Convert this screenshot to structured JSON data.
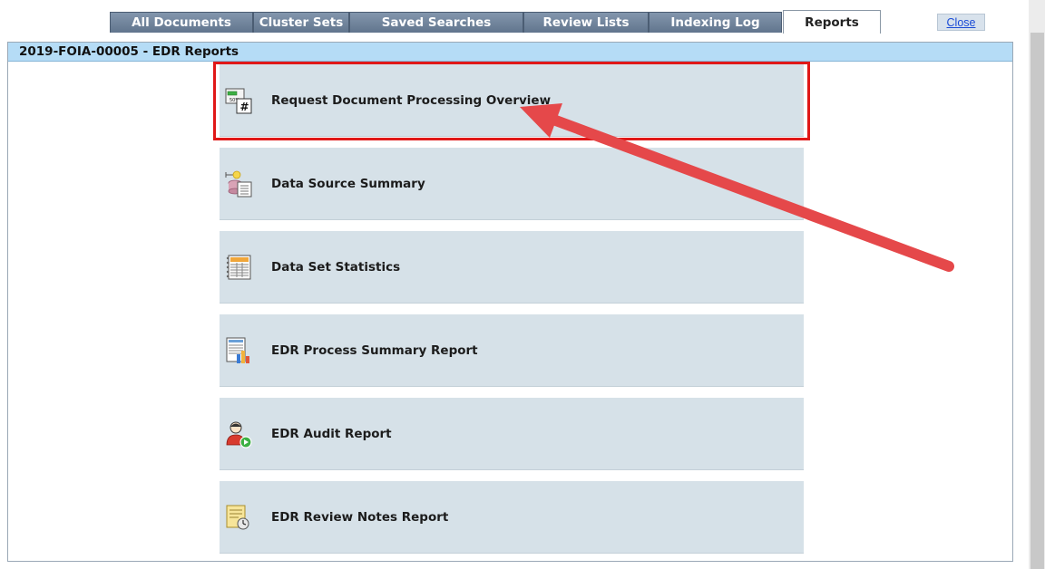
{
  "tabs": [
    {
      "label": "All Documents",
      "active": false
    },
    {
      "label": "Cluster Sets",
      "active": false
    },
    {
      "label": "Saved Searches",
      "active": false
    },
    {
      "label": "Review Lists",
      "active": false
    },
    {
      "label": "Indexing Log",
      "active": false
    },
    {
      "label": "Reports",
      "active": true
    }
  ],
  "close_label": "Close",
  "panel_title": "2019-FOIA-00005 - EDR Reports",
  "reports": [
    {
      "label": "Request Document Processing Overview",
      "icon": "processing-overview-icon",
      "highlighted": true
    },
    {
      "label": "Data Source Summary",
      "icon": "data-source-icon",
      "highlighted": false
    },
    {
      "label": "Data Set Statistics",
      "icon": "statistics-icon",
      "highlighted": false
    },
    {
      "label": "EDR Process Summary Report",
      "icon": "process-summary-icon",
      "highlighted": false
    },
    {
      "label": "EDR Audit Report",
      "icon": "audit-user-icon",
      "highlighted": false
    },
    {
      "label": "EDR Review Notes Report",
      "icon": "review-notes-icon",
      "highlighted": false
    }
  ],
  "icon_text": {
    "percent": "50%",
    "hash": "#"
  },
  "colors": {
    "tab_bg": "#6f8299",
    "panel_header_bg": "#b5dcf6",
    "report_bg": "#d6e1e8",
    "highlight": "#e01818",
    "arrow": "#e5484a"
  }
}
